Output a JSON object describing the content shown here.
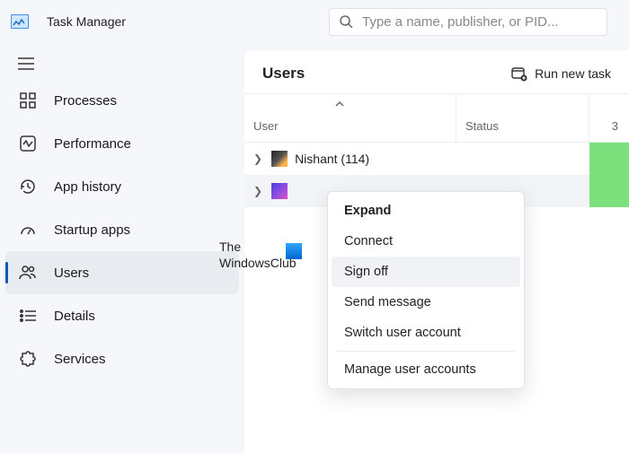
{
  "app": {
    "title": "Task Manager"
  },
  "search": {
    "placeholder": "Type a name, publisher, or PID..."
  },
  "sidebar": {
    "items": [
      {
        "label": "Processes"
      },
      {
        "label": "Performance"
      },
      {
        "label": "App history"
      },
      {
        "label": "Startup apps"
      },
      {
        "label": "Users"
      },
      {
        "label": "Details"
      },
      {
        "label": "Services"
      }
    ]
  },
  "page": {
    "title": "Users",
    "run_task": "Run new task",
    "columns": {
      "user": "User",
      "status": "Status",
      "end_value": "3"
    },
    "rows": [
      {
        "name": "Nishant (114)"
      },
      {
        "name": ""
      }
    ]
  },
  "context_menu": {
    "items": [
      "Expand",
      "Connect",
      "Sign off",
      "Send message",
      "Switch user account",
      "Manage user accounts"
    ]
  },
  "watermark": {
    "line1": "The",
    "line2": "WindowsClub"
  }
}
